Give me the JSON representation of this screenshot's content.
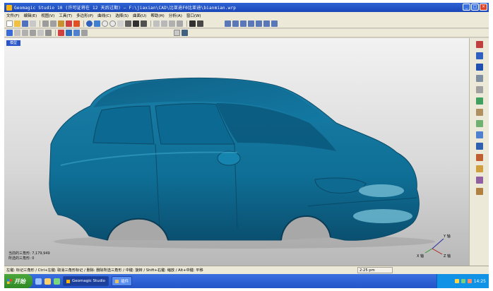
{
  "titlebar": {
    "title": "Geomagic Studio 10  (许可证将在 12 天后过期)  — F:\\jiaxian\\CAD\\比亚迪F0比亚迪\\bianmian.wrp",
    "icons": [
      "app-icon",
      "minimize-icon",
      "maximize-icon",
      "close-icon"
    ]
  },
  "menu": [
    "文件(F)",
    "编辑(E)",
    "视图(V)",
    "工具(T)",
    "多边形(P)",
    "曲线(C)",
    "选择(S)",
    "曲面(U)",
    "帮助(H)",
    "分析(A)",
    "窗口(W)"
  ],
  "colors": {
    "model": "#0f6f96",
    "model_shade": "#0a4f70",
    "model_highlight": "#3aa5c8",
    "accent": "#2a55c8"
  },
  "viewport": {
    "tab_label": "模型",
    "stats": [
      "当前的三角形: 7,179,949",
      "所选的三角形: 0"
    ]
  },
  "axis": {
    "x_label": "Y 轴",
    "y_label": "X 轴",
    "z_label": "Z 轴"
  },
  "status": {
    "hint": "左键: 标记三角形 / Ctrl+左键: 取消三角形标记 / 删除: 删除所选三角形 / 中键: 旋转 / Shift+右键: 缩放 / Alt+中键: 平移",
    "time": "2:25 pm"
  },
  "taskbar": {
    "start_label": "开始",
    "tasks": [
      {
        "label": "Geomagic Studio",
        "active": true
      },
      {
        "label": "插件",
        "active": false
      }
    ],
    "clock": "14:25"
  }
}
